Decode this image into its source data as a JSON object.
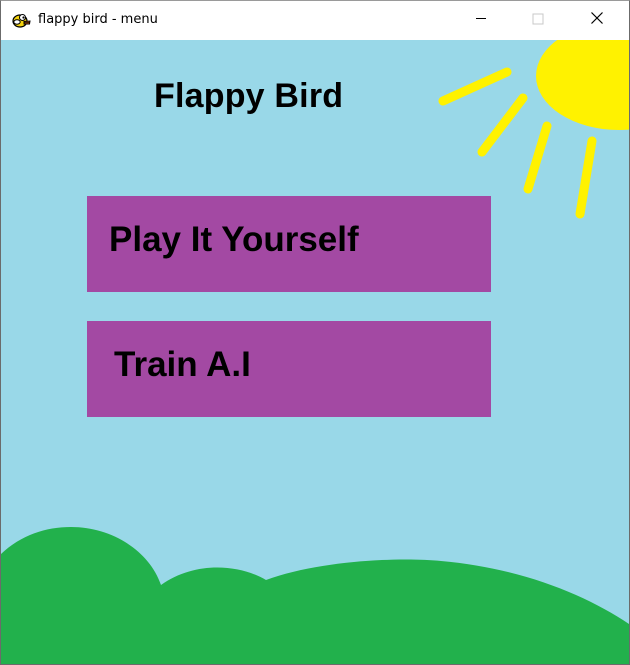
{
  "window": {
    "title": "flappy bird - menu",
    "icon": "flappy-bird-icon",
    "controls": {
      "minimize_icon": "minimize-icon",
      "maximize_icon": "maximize-icon",
      "close_icon": "close-icon"
    }
  },
  "menu": {
    "title": "Flappy Bird",
    "buttons": [
      {
        "label": "Play It Yourself"
      },
      {
        "label": "Train A.I"
      }
    ]
  },
  "colors": {
    "sky": "#99d8e8",
    "button": "#a349a3",
    "sun": "#fff200",
    "hills": "#22b14c"
  },
  "decorations": {
    "sun": "sun-icon",
    "sun_rays": "sun-rays",
    "hills": "green-hills"
  }
}
